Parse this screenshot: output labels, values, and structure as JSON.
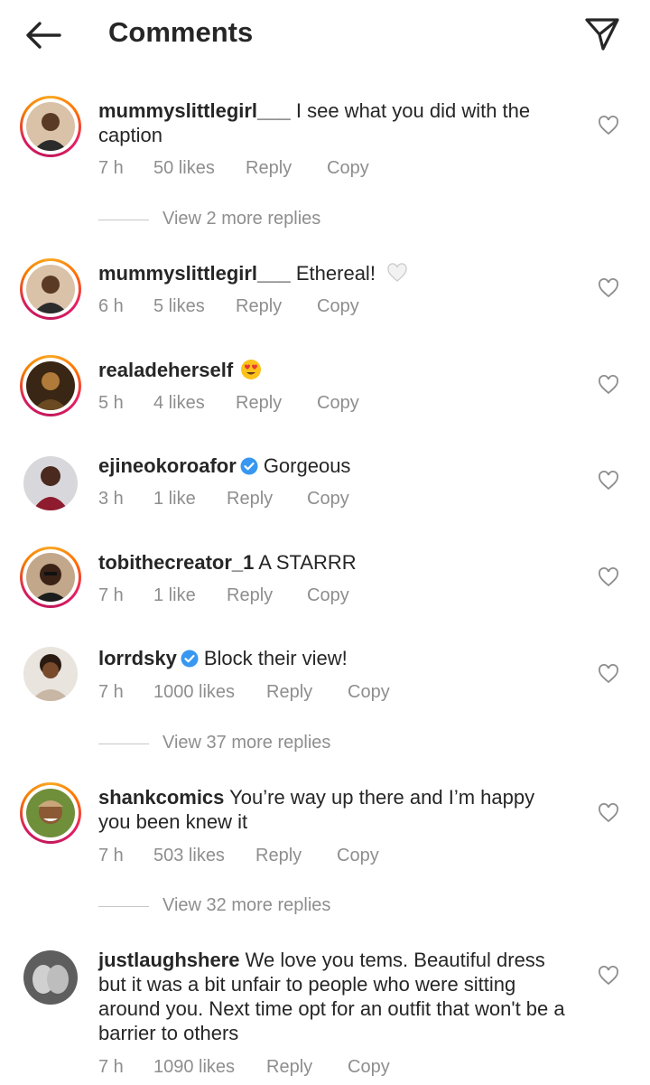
{
  "header": {
    "title": "Comments",
    "back_icon": "arrow-left-icon",
    "share_icon": "paper-plane-icon"
  },
  "comments": [
    {
      "username": "mummyslittlegirl___",
      "verified": false,
      "text": "I see what you did with the caption",
      "time": "7 h",
      "likes": "50 likes",
      "reply": "Reply",
      "copy": "Copy"
    },
    {
      "username": "mummyslittlegirl___",
      "verified": false,
      "text": "Ethereal!",
      "emoji": "white-heart",
      "time": "6 h",
      "likes": "5 likes",
      "reply": "Reply",
      "copy": "Copy"
    },
    {
      "username": "realadeherself",
      "verified": false,
      "text": "",
      "emoji": "heart-eyes",
      "time": "5 h",
      "likes": "4 likes",
      "reply": "Reply",
      "copy": "Copy"
    },
    {
      "username": "ejineokoroafor",
      "verified": true,
      "text": "Gorgeous",
      "time": "3 h",
      "likes": "1 like",
      "reply": "Reply",
      "copy": "Copy"
    },
    {
      "username": "tobithecreator_1",
      "verified": false,
      "text": "A STARRR",
      "time": "7 h",
      "likes": "1 like",
      "reply": "Reply",
      "copy": "Copy"
    },
    {
      "username": "lorrdsky",
      "verified": true,
      "text": "Block their view!",
      "time": "7 h",
      "likes": "1000 likes",
      "reply": "Reply",
      "copy": "Copy"
    },
    {
      "username": "shankcomics",
      "verified": false,
      "text": "You’re way up there and I’m happy you been knew it",
      "time": "7 h",
      "likes": "503 likes",
      "reply": "Reply",
      "copy": "Copy"
    },
    {
      "username": "justlaughshere",
      "verified": false,
      "text": "We love you tems. Beautiful dress but it was a bit unfair to people who were sitting around you. Next time opt for an outfit that won't be a barrier to others",
      "time": "7 h",
      "likes": "1090 likes",
      "reply": "Reply",
      "copy": "Copy"
    }
  ],
  "view_more": [
    {
      "label": "View 2 more replies"
    },
    {
      "label": "View 37 more replies"
    },
    {
      "label": "View 32 more replies"
    }
  ],
  "colors": {
    "text": "#262626",
    "secondary": "#8e8e8e",
    "verified": "#3897f0"
  }
}
